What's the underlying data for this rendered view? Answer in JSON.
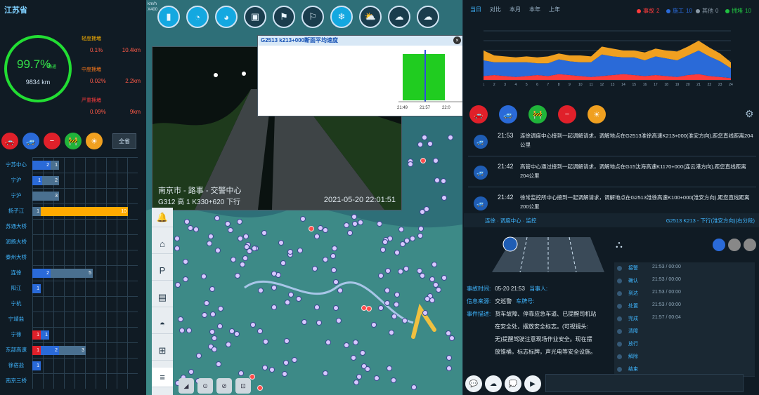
{
  "left": {
    "province": "江苏省",
    "gauge": {
      "percent": "99.7%",
      "percent_sub": "畅通",
      "km": "9834 km"
    },
    "congestion": [
      {
        "label": "轻度拥堵",
        "pct": "0.1%",
        "km": "10.4km",
        "color": "#ffb400"
      },
      {
        "label": "中度拥堵",
        "pct": "0.02%",
        "km": "2.2km",
        "color": "#ff7a1a"
      },
      {
        "label": "严重拥堵",
        "pct": "0.09%",
        "km": "9km",
        "color": "#ff3b3b"
      }
    ],
    "filter_icons": [
      {
        "name": "accident",
        "color": "#e0202a",
        "glyph": "🚗"
      },
      {
        "name": "breakdown",
        "color": "#2a6ad8",
        "glyph": "🚙"
      },
      {
        "name": "closure",
        "color": "#e0202a",
        "glyph": "−"
      },
      {
        "name": "construction",
        "color": "#20b43a",
        "glyph": "🚧"
      },
      {
        "name": "weather",
        "color": "#f0a020",
        "glyph": "☀"
      }
    ],
    "all_button": "全省",
    "rows": [
      {
        "name": "宁苏中心",
        "segs": [
          {
            "v": "2",
            "c": "#2a6ad8",
            "w": 26
          },
          {
            "v": "1",
            "c": "#4a7090",
            "w": 12
          }
        ]
      },
      {
        "name": "宁沪",
        "segs": [
          {
            "v": "1",
            "c": "#2a6ad8",
            "w": 14
          },
          {
            "v": "2",
            "c": "#4a7090",
            "w": 24
          }
        ]
      },
      {
        "name": "宁沪",
        "segs": [
          {
            "v": "3",
            "c": "#4a7090",
            "w": 38
          }
        ]
      },
      {
        "name": "扬子江",
        "segs": [
          {
            "v": "1",
            "c": "#4a7090",
            "w": 12
          },
          {
            "v": "10",
            "c": "#ffaa00",
            "w": 124
          }
        ]
      },
      {
        "name": "苏通大桥",
        "segs": []
      },
      {
        "name": "润扬大桥",
        "segs": []
      },
      {
        "name": "泰州大桥",
        "segs": []
      },
      {
        "name": "连徐",
        "segs": [
          {
            "v": "2",
            "c": "#2a6ad8",
            "w": 26
          },
          {
            "v": "5",
            "c": "#4a7090",
            "w": 60
          }
        ]
      },
      {
        "name": "阳江",
        "segs": [
          {
            "v": "1",
            "c": "#2a6ad8",
            "w": 12
          }
        ]
      },
      {
        "name": "宁杭",
        "segs": []
      },
      {
        "name": "宁靖盐",
        "segs": []
      },
      {
        "name": "宁徐",
        "segs": [
          {
            "v": "1",
            "c": "#e0202a",
            "w": 12
          },
          {
            "v": "1",
            "c": "#2a6ad8",
            "w": 12
          }
        ]
      },
      {
        "name": "东部高速",
        "segs": [
          {
            "v": "1",
            "c": "#e0202a",
            "w": 12
          },
          {
            "v": "2",
            "c": "#2a6ad8",
            "w": 26
          },
          {
            "v": "3",
            "c": "#4a7090",
            "w": 38
          }
        ]
      },
      {
        "name": "徐宿盐",
        "segs": [
          {
            "v": "1",
            "c": "#2a6ad8",
            "w": 12
          }
        ]
      },
      {
        "name": "南京三桥",
        "segs": []
      }
    ]
  },
  "map": {
    "speed_unit": "km/h",
    "speed_code": "X400",
    "top_icons": [
      {
        "name": "traffic-light",
        "glyph": "▮",
        "active": true
      },
      {
        "name": "camera-a",
        "glyph": "◔",
        "active": true
      },
      {
        "name": "camera-b",
        "glyph": "◕",
        "active": true
      },
      {
        "name": "toll-station",
        "glyph": "▣",
        "active": false
      },
      {
        "name": "flag-a",
        "glyph": "⚑",
        "active": false
      },
      {
        "name": "flag-b",
        "glyph": "⚐",
        "active": false
      },
      {
        "name": "snow",
        "glyph": "❄",
        "active": true
      },
      {
        "name": "sun-cloud",
        "glyph": "⛅",
        "active": false
      },
      {
        "name": "wind",
        "glyph": "☁",
        "active": false
      },
      {
        "name": "cloud",
        "glyph": "☁",
        "active": false
      }
    ],
    "video": {
      "caption_line1": "南京市 -  路事 - 交警中心",
      "caption_line2": "G312 高 1 K330+620 下行",
      "timestamp": "2021-05-20 22:01:51"
    },
    "speed_panel": {
      "title": "G2513 k213+000断面平均速度",
      "ticks": [
        "21:49",
        "21:57",
        "22:0"
      ]
    },
    "tools": [
      "🔔",
      "⌂",
      "P",
      "▤",
      "◓",
      "⊞",
      "≡"
    ],
    "bottom_tools": [
      "◢",
      "⊙",
      "⊘",
      "⊡"
    ],
    "colors": {
      "water": "#2e6f78",
      "land": "#3d8a87"
    }
  },
  "right": {
    "tabs": [
      {
        "label": "当日",
        "active": true
      },
      {
        "label": "对比",
        "active": false
      },
      {
        "label": "本月",
        "active": false
      },
      {
        "label": "本年",
        "active": false
      },
      {
        "label": "上年",
        "active": false
      }
    ],
    "legend": [
      {
        "label": "事故",
        "value": "2",
        "color": "#ff3b3b"
      },
      {
        "label": "施工",
        "value": "10",
        "color": "#2a6ad8"
      },
      {
        "label": "其他",
        "value": "0",
        "color": "#8a9aa8"
      },
      {
        "label": "拥堵",
        "value": "10",
        "color": "#20c040"
      }
    ],
    "chart_data": {
      "type": "area",
      "x": [
        1,
        2,
        3,
        4,
        5,
        6,
        7,
        8,
        9,
        10,
        11,
        12,
        13,
        14,
        15,
        16,
        17,
        18,
        19,
        20,
        21,
        22,
        23,
        24
      ],
      "ylim": [
        0,
        50
      ],
      "yticks": [
        0,
        10,
        20,
        30,
        40,
        50
      ],
      "series": [
        {
          "name": "",
          "color": "#ff3b3b",
          "values": [
            4,
            5,
            4,
            3,
            4,
            5,
            4,
            6,
            5,
            4,
            3,
            4,
            5,
            6,
            5,
            4,
            5,
            4,
            3,
            5,
            6,
            4,
            3,
            2
          ]
        },
        {
          "name": "",
          "color": "#2a6ad8",
          "values": [
            16,
            13,
            14,
            15,
            14,
            12,
            13,
            15,
            14,
            14,
            15,
            22,
            19,
            17,
            18,
            16,
            19,
            18,
            17,
            20,
            24,
            20,
            16,
            10
          ]
        },
        {
          "name": "",
          "color": "#f0a020",
          "values": [
            10,
            7,
            6,
            5,
            6,
            6,
            7,
            6,
            6,
            7,
            6,
            8,
            8,
            7,
            7,
            8,
            8,
            8,
            9,
            9,
            10,
            9,
            8,
            6
          ]
        }
      ]
    },
    "action_icons": [
      {
        "name": "accident",
        "color": "#e0202a",
        "glyph": "🚗"
      },
      {
        "name": "breakdown",
        "color": "#2a6ad8",
        "glyph": "🚙"
      },
      {
        "name": "construction",
        "color": "#20b43a",
        "glyph": "🚧"
      },
      {
        "name": "closure",
        "color": "#e0202a",
        "glyph": "−"
      },
      {
        "name": "weather",
        "color": "#f0a020",
        "glyph": "☀"
      }
    ],
    "events": [
      {
        "time": "21:53",
        "text": "连徐调度中心接到一起调解请求，调解地点在G2513淮徐高速K213+000(淮安方向),距您直线距离204公里"
      },
      {
        "time": "21:42",
        "text": "高管中心通过接到一起调解请求，调解地点在G15沈海高速K1170+000(连云港方向),距您直线距离204公里"
      },
      {
        "time": "21:42",
        "text": "徐常监控所中心接到一起调解请求，调解地点在G2513淮徐高速K100+000(淮安方向),距您直线距离200公里"
      }
    ],
    "detail_header": {
      "left": "连徐 · 调度中心 · 监控",
      "right": "G2513 K213 - 下行(淮安方向)(右分段)"
    },
    "detail": {
      "time_label": "事故时间:",
      "time_value": "05-20 21:53",
      "reporter_label": "当事人:",
      "source_label": "信息来源:",
      "source_value": "交巡警",
      "plate_label": "车牌号:",
      "desc_label": "事件描述:",
      "desc_lines": [
        "货车故障、停靠应急车道、已提醒司机站",
        "在安全处，摆放安全标志。(可视镜头:",
        "无)提醒驾驶注意现场作业安全。现在摆",
        "放锥桶，标志标牌，声光电等安全设施。"
      ]
    },
    "process": [
      {
        "name": "接警",
        "time": "21:53 / 00:00"
      },
      {
        "name": "确认",
        "time": "21:53 / 00:00"
      },
      {
        "name": "到达",
        "time": "21:53 / 00:00"
      },
      {
        "name": "处置",
        "time": "21:53 / 00:00"
      },
      {
        "name": "完成",
        "time": "21:57 / 00:04"
      },
      {
        "name": "清障",
        "time": ""
      },
      {
        "name": "放行",
        "time": ""
      },
      {
        "name": "解除",
        "time": ""
      },
      {
        "name": "结束",
        "time": ""
      }
    ],
    "chat_icons": [
      "💬",
      "☁",
      "💭",
      "▶"
    ]
  }
}
